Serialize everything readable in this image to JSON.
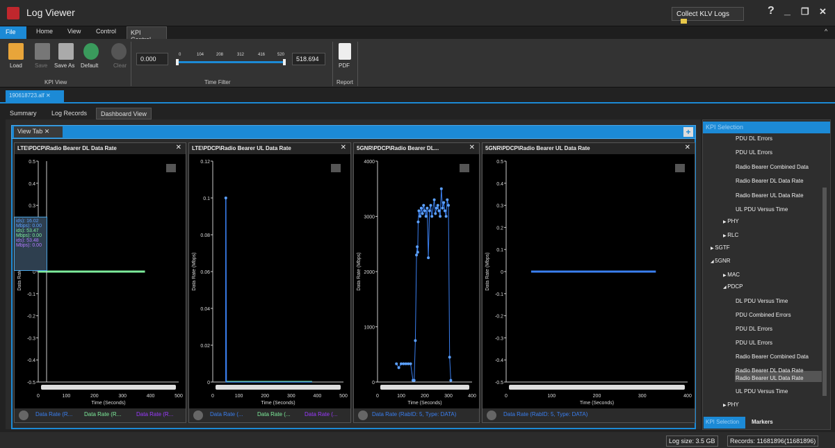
{
  "title": "Log Viewer",
  "collect_label": "Collect KLV Logs",
  "win": {
    "help": "?",
    "min": "_",
    "max": "❐",
    "close": "✕"
  },
  "ribbon_tabs": [
    "File",
    "Home",
    "View",
    "Control",
    "KPI Control"
  ],
  "ribbon": {
    "load": "Load",
    "save": "Save",
    "save_as": "Save As",
    "default": "Default",
    "clear": "Clear",
    "kpi_view": "KPI View",
    "start_value": "0.000",
    "ticks": [
      "0",
      "104",
      "208",
      "312",
      "416",
      "520"
    ],
    "end_value": "518.694",
    "time_filter": "Time Filter",
    "pdf": "PDF",
    "report": "Report"
  },
  "doc_tab": "190618723.alf ✕",
  "view_tabs": [
    "Summary",
    "Log Records",
    "Dashboard View"
  ],
  "view_tab": "View Tab ✕",
  "charts": [
    {
      "title": "LTE\\PDCP\\Radio Bearer DL Data Rate",
      "legend": [
        "Data Rate (R...",
        "Data Rate (R...",
        "Data Rate (R..."
      ],
      "legend_colors": [
        "#3a7ff0",
        "#7dec9b",
        "#9b3aff"
      ]
    },
    {
      "title": "LTE\\PDCP\\Radio Bearer UL Data Rate",
      "legend": [
        "Data Rate (...",
        "Data Rate (...",
        "Data Rate (..."
      ],
      "legend_colors": [
        "#3a7ff0",
        "#7dec9b",
        "#9b3aff"
      ]
    },
    {
      "title": "5GNR\\PDCP\\Radio Bearer DL...",
      "legend": [
        "Data Rate (RabID: 5, Type: DATA)"
      ],
      "legend_colors": [
        "#3a7ff0"
      ]
    },
    {
      "title": "5GNR\\PDCP\\Radio Bearer UL Data Rate",
      "legend": [
        "Data Rate (RabID: 5, Type: DATA)"
      ],
      "legend_colors": [
        "#3a7ff0"
      ]
    }
  ],
  "chart_data": [
    {
      "type": "line",
      "title": "LTE\\PDCP\\Radio Bearer DL Data Rate",
      "xlabel": "Time (Seconds)",
      "ylabel": "Data Rate (Mbps)",
      "xlim": [
        0,
        500
      ],
      "ylim": [
        -0.5,
        0.5
      ],
      "xticks": [
        "0",
        "100",
        "200",
        "300",
        "400",
        "500"
      ],
      "yticks": [
        "0.5",
        "0.4",
        "0.3",
        "0.2",
        "0.1",
        "0",
        "-0.1",
        "-0.2",
        "-0.3",
        "-0.4",
        "-0.5"
      ],
      "series": [
        {
          "x": [
            0,
            380
          ],
          "y": [
            0,
            0
          ]
        }
      ],
      "tooltip": [
        "ids): 16.02",
        "Mbps): 0.00",
        "ids): 53.47",
        "Mbps): 0.00",
        "ids): 53.48",
        "Mbps): 0.00"
      ]
    },
    {
      "type": "line",
      "title": "LTE\\PDCP\\Radio Bearer UL Data Rate",
      "xlabel": "Time (Seconds)",
      "ylabel": "Data Rate (Mbps)",
      "xlim": [
        0,
        500
      ],
      "ylim": [
        0,
        0.12
      ],
      "xticks": [
        "0",
        "100",
        "200",
        "300",
        "400",
        "500"
      ],
      "yticks": [
        "0.12",
        "0.1",
        "0.08",
        "0.06",
        "0.04",
        "0.02",
        "0"
      ],
      "series": [
        {
          "x": [
            50,
            50,
            52,
            380
          ],
          "y": [
            0,
            0.1,
            0,
            0
          ]
        }
      ]
    },
    {
      "type": "scatter",
      "title": "5GNR\\PDCP\\Radio Bearer DL...",
      "xlabel": "Time (Seconds)",
      "ylabel": "Data Rate (Mbps)",
      "xlim": [
        0,
        400
      ],
      "ylim": [
        0,
        4000
      ],
      "xticks": [
        "0",
        "100",
        "200",
        "300",
        "400"
      ],
      "yticks": [
        "4000",
        "3000",
        "2000",
        "1000",
        "0"
      ],
      "series": [
        {
          "x": [
            80,
            90,
            100,
            110,
            120,
            130,
            140,
            150,
            155,
            160,
            165,
            168,
            170,
            172,
            175,
            180,
            185,
            190,
            195,
            200,
            205,
            210,
            215,
            220,
            225,
            230,
            240,
            245,
            250,
            255,
            260,
            265,
            270,
            275,
            280,
            285,
            290,
            295,
            300,
            305,
            310
          ],
          "y": [
            330,
            260,
            330,
            330,
            330,
            330,
            330,
            30,
            30,
            750,
            2300,
            2450,
            2350,
            2900,
            3100,
            3000,
            3150,
            3050,
            3200,
            3100,
            3000,
            3150,
            2250,
            3100,
            3200,
            3000,
            3300,
            3050,
            3150,
            3200,
            3100,
            3000,
            3500,
            3150,
            3250,
            3100,
            3000,
            3300,
            3200,
            450,
            30
          ]
        }
      ]
    },
    {
      "type": "line",
      "title": "5GNR\\PDCP\\Radio Bearer UL Data Rate",
      "xlabel": "Time (Seconds)",
      "ylabel": "Data Rate (Mbps)",
      "xlim": [
        0,
        400
      ],
      "ylim": [
        -0.5,
        0.5
      ],
      "xticks": [
        "0",
        "100",
        "200",
        "300",
        "400"
      ],
      "yticks": [
        "0.5",
        "0.4",
        "0.3",
        "0.2",
        "0.1",
        "0",
        "-0.1",
        "-0.2",
        "-0.3",
        "-0.4",
        "-0.5"
      ],
      "series": [
        {
          "x": [
            55,
            330
          ],
          "y": [
            0,
            0
          ]
        }
      ]
    }
  ],
  "kpi": {
    "header": "KPI Selection",
    "items": [
      "PDU DL Errors",
      "PDU UL Errors",
      "Radio Bearer Combined Data",
      "Radio Bearer DL Data Rate",
      "Radio Bearer UL Data Rate",
      "UL PDU Versus Time",
      "PHY",
      "RLC",
      "SGTF",
      "5GNR",
      "MAC",
      "PDCP",
      "DL PDU Versus Time",
      "PDU Combined Errors",
      "PDU DL Errors",
      "PDU UL Errors",
      "Radio Bearer Combined Data",
      "Radio Bearer DL Data Rate",
      "Radio Bearer UL Data Rate",
      "UL PDU Versus Time",
      "PHY"
    ],
    "tab_sel": "KPI Selection",
    "tab_markers": "Markers"
  },
  "status": {
    "size": "Log size: 3.5 GB",
    "records": "Records: 11681896(11681896)"
  }
}
